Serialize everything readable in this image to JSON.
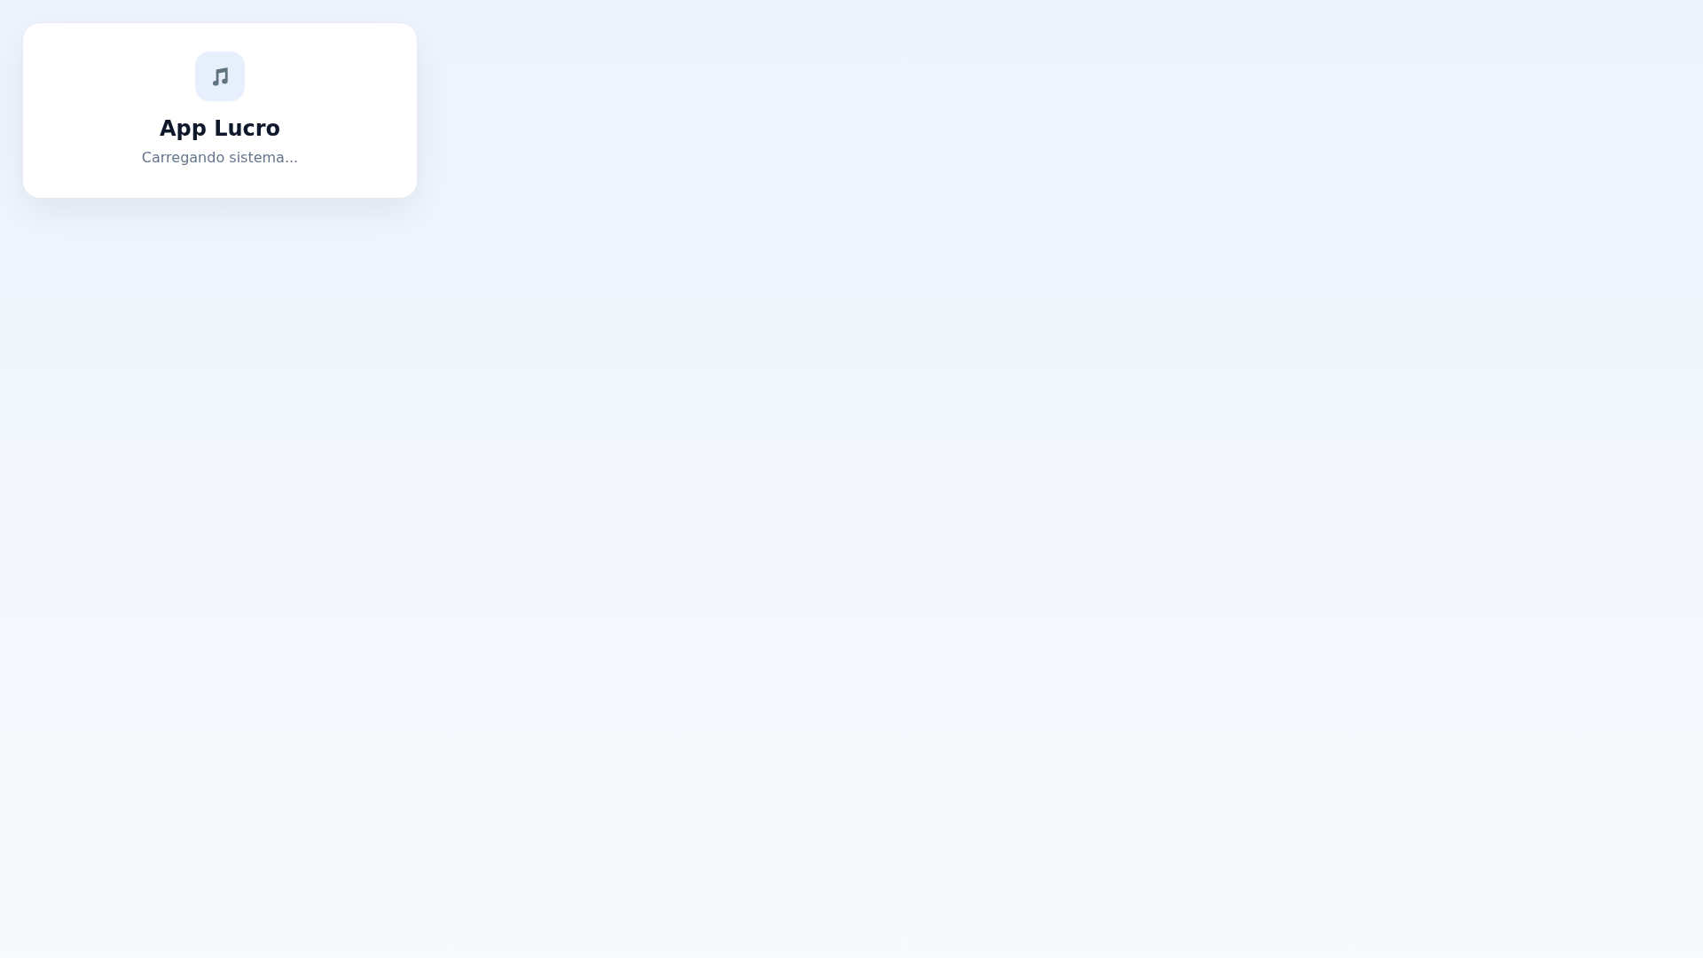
{
  "loader": {
    "title": "App Lucro",
    "message": "Carregando sistema..."
  }
}
